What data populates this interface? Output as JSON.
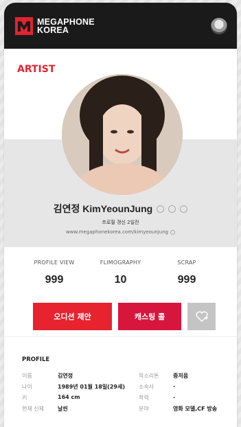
{
  "header": {
    "logo_line1": "MEGAPHONE",
    "logo_line2": "KOREA",
    "brand_color": "#e0242f"
  },
  "section": {
    "label": "ARTIST"
  },
  "artist": {
    "name": "김연정 KimYeounJung",
    "updated": "프로필 갱신 2일전",
    "url": "www.megaphonekorea.com/kimyeounjung",
    "sns_icons": [
      "facebook-icon",
      "instagram-icon",
      "youtube-icon"
    ]
  },
  "stats": [
    {
      "label": "PROFILE VIEW",
      "value": "999"
    },
    {
      "label": "FLIMOGRAPHY",
      "value": "10"
    },
    {
      "label": "SCRAP",
      "value": "999"
    }
  ],
  "buttons": {
    "audition": "오디션 제안",
    "casting": "캐스팅 콜"
  },
  "profile": {
    "title": "PROFILE",
    "rows": [
      {
        "k1": "이름",
        "v1": "김연정",
        "k2": "목소리톤",
        "v2": "중저음"
      },
      {
        "k1": "나이",
        "v1": "1989년 01월 18일(29세)",
        "k2": "소속사",
        "v2": "-"
      },
      {
        "k1": "키",
        "v1": "164 cm",
        "k2": "학력",
        "v2": "-"
      },
      {
        "k1": "현재 신체",
        "v1": "날씬",
        "k2": "분야",
        "v2": "영화 모델,CF 방송"
      }
    ]
  }
}
